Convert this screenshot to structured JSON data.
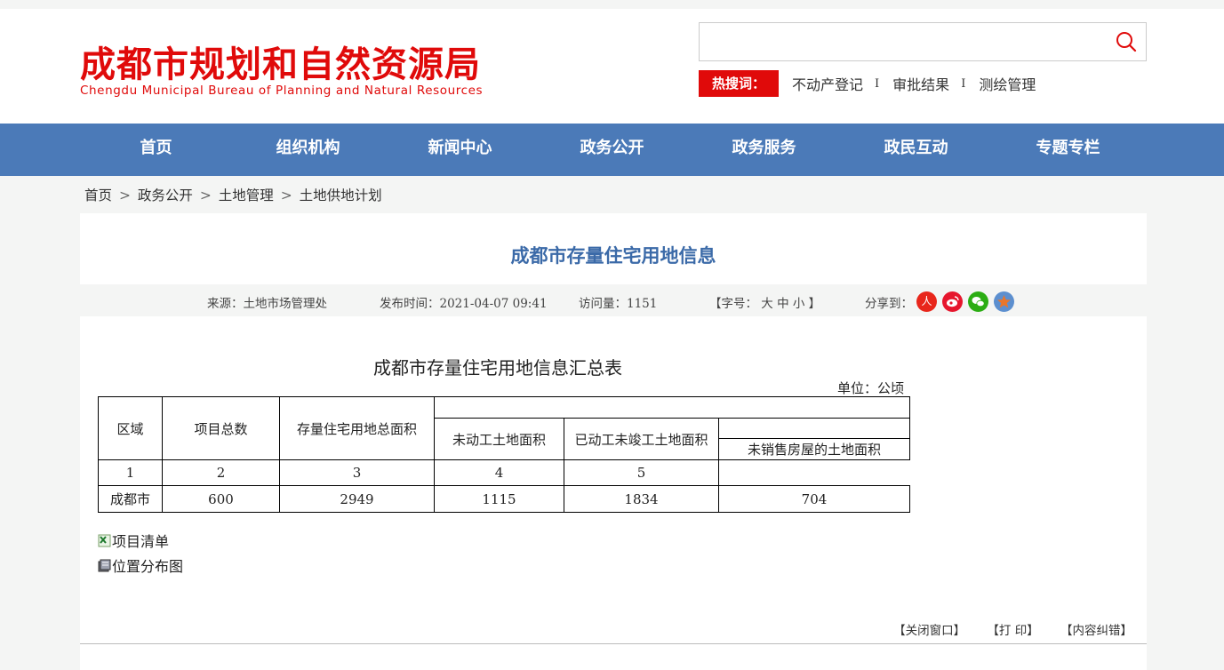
{
  "header": {
    "title_cn": "成都市规划和自然资源局",
    "title_en": "Chengdu Municipal Bureau of Planning and Natural Resources"
  },
  "search": {
    "placeholder": "",
    "hot_label": "热搜词：",
    "hot_words": [
      "不动产登记",
      "审批结果",
      "测绘管理"
    ],
    "separator": "I"
  },
  "nav": {
    "items": [
      "首页",
      "组织机构",
      "新闻中心",
      "政务公开",
      "政务服务",
      "政民互动",
      "专题专栏"
    ]
  },
  "breadcrumb": {
    "items": [
      "首页",
      "政务公开",
      "土地管理",
      "土地供地计划"
    ],
    "separator": ">"
  },
  "article": {
    "title": "成都市存量住宅用地信息",
    "source": "来源：土地市场管理处",
    "published": "发布时间：2021-04-07 09:41",
    "views": "访问量：1151",
    "font_size": "【字号： 大 中 小 】",
    "share_label": "分享到："
  },
  "table": {
    "title": "成都市存量住宅用地信息汇总表",
    "unit": "单位：公顷",
    "headers": {
      "region": "区域",
      "project_count": "项目总数",
      "total_area": "存量住宅用地总面积",
      "not_started": "未动工土地面积",
      "started_unfinished": "已动工未竣工土地面积",
      "unsold": "未销售房屋的土地面积"
    },
    "index_row": [
      "1",
      "2",
      "3",
      "4",
      "5"
    ],
    "rows": [
      {
        "region": "成都市",
        "values": [
          "600",
          "2949",
          "1115",
          "1834",
          "704"
        ]
      }
    ]
  },
  "attachments": [
    "项目清单",
    "位置分布图"
  ],
  "actions": {
    "close": "【关闭窗口】",
    "print": "【打 印】",
    "correct": "【内容纠错】"
  },
  "colors": {
    "brand_red": "#e00a0a",
    "nav_blue": "#4b7ab8",
    "title_blue": "#3b6aa8"
  }
}
